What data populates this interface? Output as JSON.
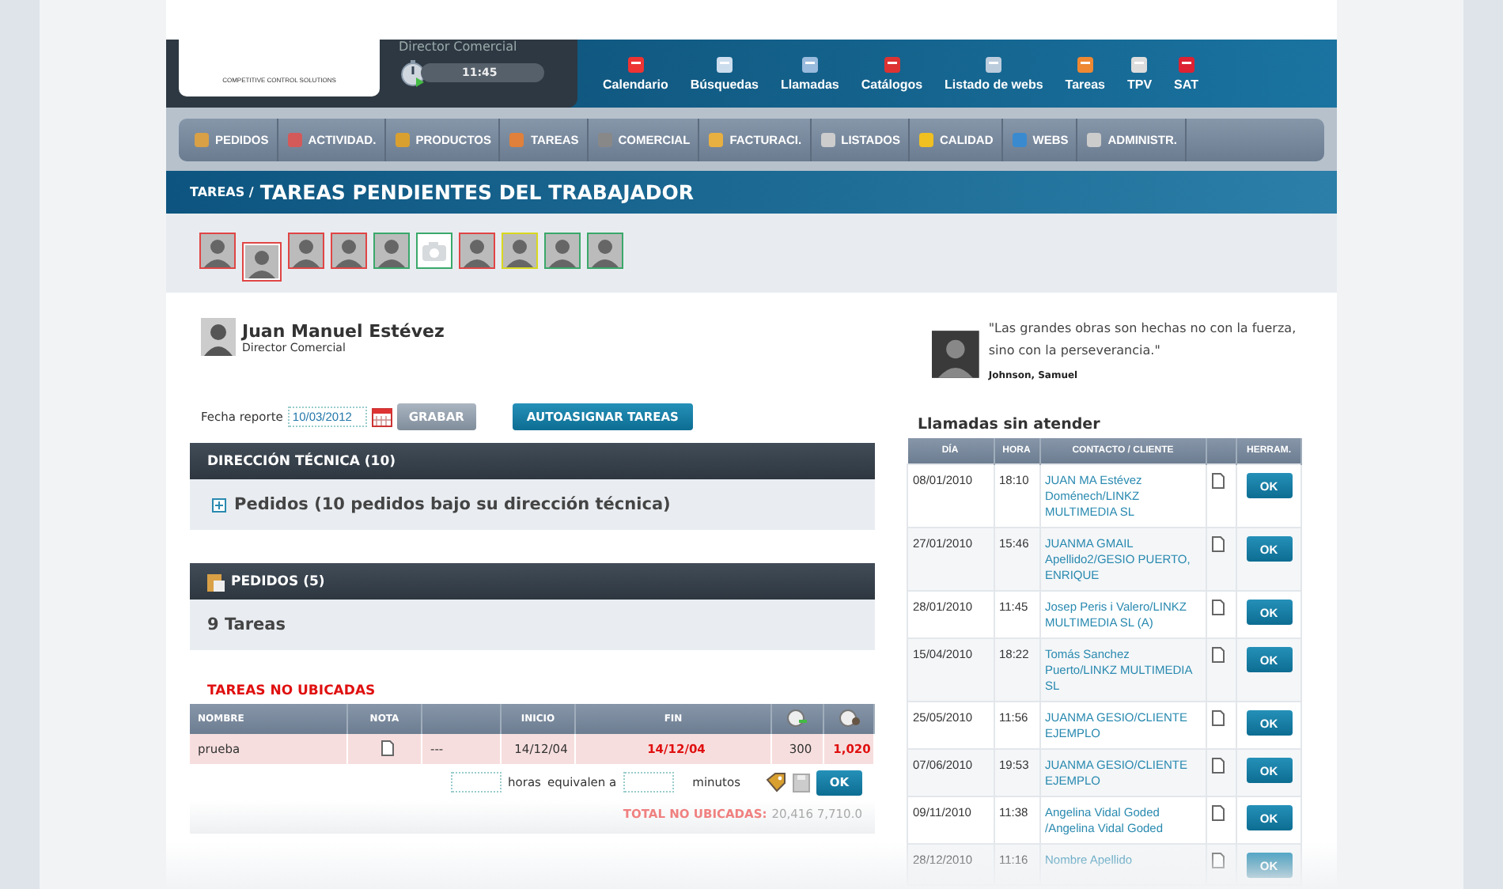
{
  "header": {
    "logo_tagline": "COMPETITIVE CONTROL SOLUTIONS",
    "role": "Director Comercial",
    "clock": "11:45",
    "quick_links": [
      {
        "label": "Calendario"
      },
      {
        "label": "Búsquedas"
      },
      {
        "label": "Llamadas"
      },
      {
        "label": "Catálogos"
      },
      {
        "label": "Listado de webs"
      },
      {
        "label": "Tareas"
      },
      {
        "label": "TPV"
      },
      {
        "label": "SAT"
      }
    ]
  },
  "nav": {
    "items": [
      {
        "label": "PEDIDOS"
      },
      {
        "label": "ACTIVIDAD."
      },
      {
        "label": "PRODUCTOS"
      },
      {
        "label": "TAREAS"
      },
      {
        "label": "COMERCIAL"
      },
      {
        "label": "FACTURACI."
      },
      {
        "label": "LISTADOS"
      },
      {
        "label": "CALIDAD"
      },
      {
        "label": "WEBS"
      },
      {
        "label": "ADMINISTR."
      }
    ]
  },
  "breadcrumb": {
    "parent": "TAREAS /",
    "title": "TAREAS PENDIENTES DEL TRABAJADOR"
  },
  "workers": [
    {
      "kind": "photo",
      "color": "#e04545",
      "selected": false
    },
    {
      "kind": "photo",
      "color": "#e04545",
      "selected": true
    },
    {
      "kind": "photo",
      "color": "#e04545",
      "selected": false
    },
    {
      "kind": "photo",
      "color": "#e04545",
      "selected": false
    },
    {
      "kind": "photo",
      "color": "#3aa86a",
      "selected": false
    },
    {
      "kind": "no_photo",
      "color": "#3aa86a",
      "selected": false
    },
    {
      "kind": "photo",
      "color": "#e04545",
      "selected": false
    },
    {
      "kind": "photo",
      "color": "#d8d820",
      "selected": false
    },
    {
      "kind": "photo",
      "color": "#3aa86a",
      "selected": false
    },
    {
      "kind": "photo",
      "color": "#3aa86a",
      "selected": false
    }
  ],
  "profile": {
    "name": "Juan Manuel Estévez",
    "role": "Director Comercial"
  },
  "report": {
    "label": "Fecha reporte",
    "date": "10/03/2012",
    "save_button": "GRABAR",
    "assign_button": "AUTOASIGNAR TAREAS"
  },
  "sections": [
    {
      "kind": "expandable",
      "title": "DIRECCIÓN TÉCNICA (10)",
      "body": "Pedidos (10 pedidos bajo su dirección técnica)"
    },
    {
      "kind": "orders",
      "title": "PEDIDOS (5)",
      "body": "9 Tareas"
    }
  ],
  "unplaced": {
    "title": "TAREAS NO UBICADAS",
    "columns": [
      "NOMBRE",
      "NOTA",
      "INICIO",
      "FIN"
    ],
    "rows": [
      {
        "name": "prueba",
        "dash": "---",
        "start": "14/12/04",
        "end": "14/12/04",
        "value_1": "300",
        "value_2": "1,020"
      }
    ],
    "conversion": {
      "hours": "horas",
      "equivalent": "equivalen a",
      "minutes": "minutos",
      "button": "OK"
    },
    "total_label": "TOTAL NO UBICADAS:",
    "total_values": "20,416 7,710.0"
  },
  "quote": {
    "text": "\"Las grandes obras son hechas no con la fuerza, sino con la perseverancia.\"",
    "author": "Johnson, Samuel"
  },
  "calls": {
    "title": "Llamadas sin atender",
    "columns": [
      "DÍA",
      "HORA",
      "CONTACTO / CLIENTE",
      "HERRAM."
    ],
    "rows": [
      {
        "date": "08/01/2010",
        "time": "18:10",
        "contact": "JUAN MA Estévez Doménech/LINKZ MULTIMEDIA SL",
        "button": "OK"
      },
      {
        "date": "27/01/2010",
        "time": "15:46",
        "contact": "JUANMA GMAIL Apellido2/GESIO PUERTO, ENRIQUE",
        "button": "OK"
      },
      {
        "date": "28/01/2010",
        "time": "11:45",
        "contact": "Josep Peris i Valero/LINKZ MULTIMEDIA SL (A)",
        "button": "OK"
      },
      {
        "date": "15/04/2010",
        "time": "18:22",
        "contact": "Tomás Sanchez Puerto/LINKZ MULTIMEDIA SL",
        "button": "OK"
      },
      {
        "date": "25/05/2010",
        "time": "11:56",
        "contact": "JUANMA GESIO/CLIENTE EJEMPLO",
        "button": "OK"
      },
      {
        "date": "07/06/2010",
        "time": "19:53",
        "contact": "JUANMA GESIO/CLIENTE EJEMPLO",
        "button": "OK"
      },
      {
        "date": "09/11/2010",
        "time": "11:38",
        "contact": "Angelina Vidal Goded /Angelina Vidal Goded",
        "button": "OK"
      },
      {
        "date": "28/12/2010",
        "time": "11:16",
        "contact": "Nombre Apellido",
        "button": "OK"
      }
    ]
  }
}
